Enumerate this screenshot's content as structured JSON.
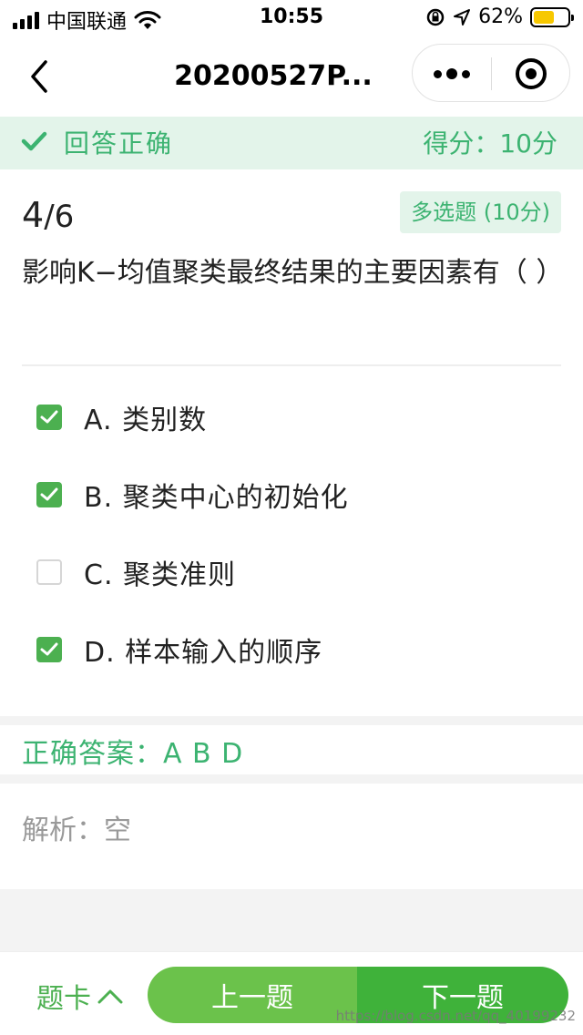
{
  "status_bar": {
    "carrier": "中国联通",
    "time": "10:55",
    "battery_percent": "62%",
    "battery_level": 0.62,
    "icons": [
      "signal-icon",
      "wifi-icon",
      "rotation-lock-icon",
      "location-icon",
      "battery-icon"
    ]
  },
  "nav": {
    "title": "20200527P...",
    "icons": [
      "back-chevron-icon",
      "more-dots-icon",
      "close-target-icon"
    ]
  },
  "result": {
    "status": "回答正确",
    "score": "得分：10分",
    "icon": "check-icon",
    "color": "#3cb371"
  },
  "question": {
    "current": "4",
    "total": "/6",
    "type": "多选题 (10分)",
    "text": "影响K−均值聚类最终结果的主要因素有（ ）",
    "options": [
      {
        "label": "A. 类别数",
        "checked": true
      },
      {
        "label": "B. 聚类中心的初始化",
        "checked": true
      },
      {
        "label": "C. 聚类准则",
        "checked": false
      },
      {
        "label": "D. 样本输入的顺序",
        "checked": true
      }
    ]
  },
  "answer": {
    "label": "正确答案：",
    "value": "A B D"
  },
  "analysis": {
    "label": "解析：",
    "value": "空"
  },
  "bottom": {
    "card_label": "题卡",
    "prev_label": "上一题",
    "next_label": "下一题",
    "accent": "#4cb050"
  },
  "watermark": "https://blog.csdn.net/qq_40199232"
}
